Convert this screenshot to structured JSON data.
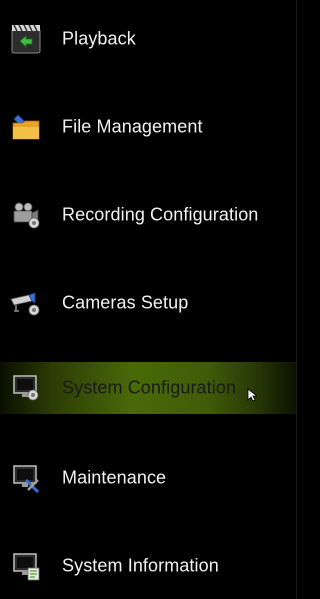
{
  "menu": {
    "items": [
      {
        "label": "Playback",
        "icon": "playback-icon",
        "selected": false
      },
      {
        "label": "File Management",
        "icon": "folder-icon",
        "selected": false
      },
      {
        "label": "Recording Configuration",
        "icon": "video-camera-icon",
        "selected": false
      },
      {
        "label": "Cameras Setup",
        "icon": "camera-setup-icon",
        "selected": false
      },
      {
        "label": "System Configuration",
        "icon": "system-config-icon",
        "selected": true
      },
      {
        "label": "Maintenance",
        "icon": "maintenance-icon",
        "selected": false
      },
      {
        "label": "System Information",
        "icon": "system-info-icon",
        "selected": false
      }
    ]
  },
  "colors": {
    "background": "#000000",
    "text": "#f2f2f2",
    "selected_highlight": "#4a6a08",
    "selected_text": "#1a1a1a"
  }
}
